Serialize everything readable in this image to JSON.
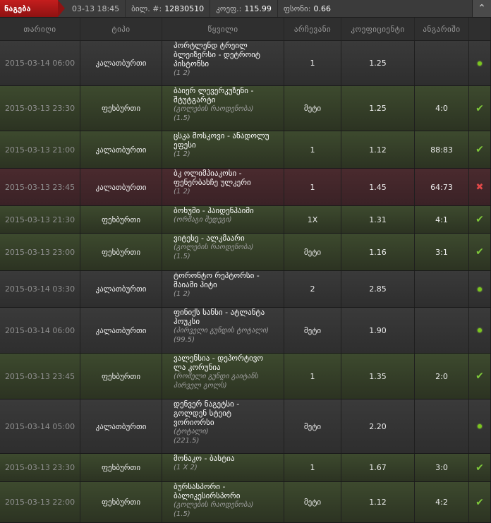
{
  "topbar": {
    "tag": "ნაგება",
    "datetime": "03-13 18:45",
    "ticket_label": "ბილ. #:",
    "ticket_value": "12830510",
    "odds_label": "კოეფ.:",
    "odds_value": "115.99",
    "bonus_label": "ფსონი:",
    "bonus_value": "0.66",
    "collapse_icon": "chevron-up-icon"
  },
  "columns": [
    "თარიღი",
    "ტიპი",
    "წყვილი",
    "არჩევანი",
    "კოეფიციენტი",
    "ანგარიში"
  ],
  "colors": {
    "won": "#3d4a2e",
    "lost": "#4a2a2e",
    "pending": "#3a3a3a",
    "accent": "#c41d1d",
    "check": "#7ec83a",
    "cross": "#e24848"
  },
  "rows": [
    {
      "date": "2015-03-14 06:00",
      "type": "კალათბურთი",
      "event_line1": "პორტლენდ ტრეილ",
      "event_line2": "ბლეიზერსი - დეტროიტ",
      "event_line3": "პისტონსი",
      "event_sub": "(1 2)",
      "pick": "1",
      "odds": "1.25",
      "result": "",
      "status": "pending"
    },
    {
      "date": "2015-03-13 23:30",
      "type": "ფეხბურთი",
      "event_line1": "ბაიერ ლევერკუზენი -",
      "event_line2": "შტუტგარტი",
      "event_line3": "",
      "event_sub": "(გოლების რაოდენობა)",
      "event_sub2": "(1.5)",
      "pick": "მეტი",
      "odds": "1.25",
      "result": "4:0",
      "status": "won"
    },
    {
      "date": "2015-03-13 21:00",
      "type": "კალათბურთი",
      "event_line1": "ცსკა მოსკოვი - ანადოლუ",
      "event_line2": "ეფესი",
      "event_line3": "",
      "event_sub": "(1 2)",
      "pick": "1",
      "odds": "1.12",
      "result": "88:83",
      "status": "won"
    },
    {
      "date": "2015-03-13 23:45",
      "type": "კალათბურთი",
      "event_line1": "ბკ ოლიმპიაკოსი -",
      "event_line2": "ფენერბახჩე ულკერი",
      "event_line3": "",
      "event_sub": "(1 2)",
      "pick": "1",
      "odds": "1.45",
      "result": "64:73",
      "status": "lost"
    },
    {
      "date": "2015-03-13 21:30",
      "type": "ფეხბურთი",
      "event_line1": "ბოხუმი - ჰაიდენჰაიმი",
      "event_line2": "",
      "event_line3": "",
      "event_sub": "(ორმაგი შედეგი)",
      "pick": "1X",
      "odds": "1.31",
      "result": "4:1",
      "status": "won"
    },
    {
      "date": "2015-03-13 23:00",
      "type": "ფეხბურთი",
      "event_line1": "ვიტესე - ალკმაარი",
      "event_line2": "",
      "event_line3": "",
      "event_sub": "(გოლების რაოდენობა)",
      "event_sub2": "(1.5)",
      "pick": "მეტი",
      "odds": "1.16",
      "result": "3:1",
      "status": "won"
    },
    {
      "date": "2015-03-14 03:30",
      "type": "კალათბურთი",
      "event_line1": "ტორონტო რეპტორსი -",
      "event_line2": "მაიამი ჰიტი",
      "event_line3": "",
      "event_sub": "(1 2)",
      "pick": "2",
      "odds": "2.85",
      "result": "",
      "status": "pending"
    },
    {
      "date": "2015-03-14 06:00",
      "type": "კალათბურთი",
      "event_line1": "ფინიქს სანსი - ატლანტა",
      "event_line2": "ჰოუკსი",
      "event_line3": "",
      "event_sub": "(პირველი გუნდის ტოტალი)",
      "event_sub2": "(99.5)",
      "pick": "მეტი",
      "odds": "1.90",
      "result": "",
      "status": "pending"
    },
    {
      "date": "2015-03-13 23:45",
      "type": "ფეხბურთი",
      "event_line1": "ვალენსია - დეპორტივო",
      "event_line2": "ლა კორუნია",
      "event_line3": "",
      "event_sub": "(რომელი გუნდი გაიტანს",
      "event_sub2": "პირველ გოლს)",
      "pick": "1",
      "odds": "1.35",
      "result": "2:0",
      "status": "won"
    },
    {
      "date": "2015-03-14 05:00",
      "type": "კალათბურთი",
      "event_line1": "დენვერ ნაგეტსი -",
      "event_line2": "გოლდენ სტეიტ",
      "event_line3": "ვორიორსი",
      "event_sub": "(ტოტალი)",
      "event_sub2": "(221.5)",
      "pick": "მეტი",
      "odds": "2.20",
      "result": "",
      "status": "pending"
    },
    {
      "date": "2015-03-13 23:30",
      "type": "ფეხბურთი",
      "event_line1": "მონაკო - ბასტია",
      "event_line2": "",
      "event_line3": "",
      "event_sub": "(1 X 2)",
      "pick": "1",
      "odds": "1.67",
      "result": "3:0",
      "status": "won"
    },
    {
      "date": "2015-03-13 22:00",
      "type": "ფეხბურთი",
      "event_line1": "ბურსასპორი -",
      "event_line2": "ბალიკესირსპორი",
      "event_line3": "",
      "event_sub": "(გოლების რაოდენობა)",
      "event_sub2": "(1.5)",
      "pick": "მეტი",
      "odds": "1.12",
      "result": "4:2",
      "status": "won"
    }
  ]
}
